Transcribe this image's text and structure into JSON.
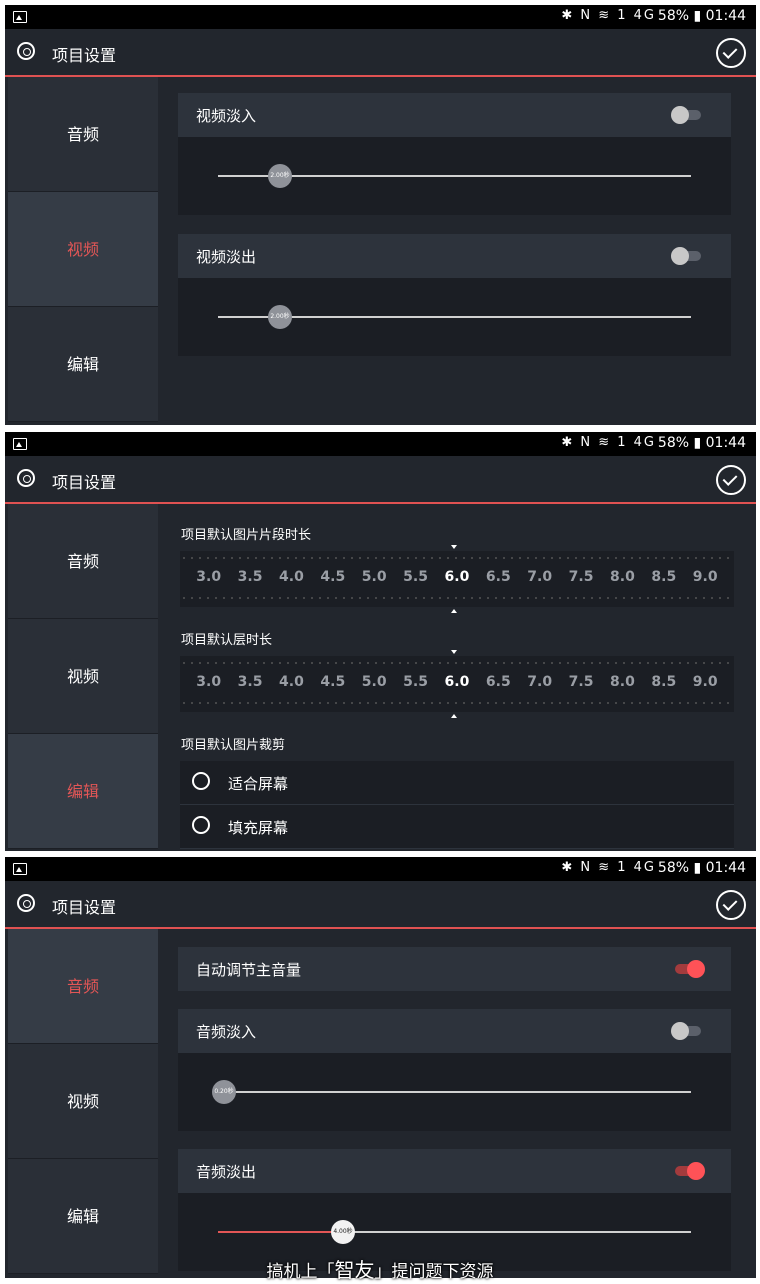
{
  "status_bar": {
    "icons": "✱ N ≋ 1 4G",
    "battery": "58%",
    "time": "01:44"
  },
  "app_bar": {
    "title": "项目设置"
  },
  "sidebar": {
    "audio": "音频",
    "video": "视频",
    "edit": "编辑"
  },
  "video_panel": {
    "fade_in": {
      "label": "视频淡入",
      "value_label": "2.00秒",
      "enabled": false,
      "position": 0.14
    },
    "fade_out": {
      "label": "视频淡出",
      "value_label": "2.00秒",
      "enabled": false,
      "position": 0.14
    }
  },
  "edit_panel": {
    "image_clip_duration": {
      "label": "项目默认图片片段时长",
      "values": [
        "3.0",
        "3.5",
        "4.0",
        "4.5",
        "5.0",
        "5.5",
        "6.0",
        "6.5",
        "7.0",
        "7.5",
        "8.0",
        "8.5",
        "9.0"
      ],
      "selected": "6.0"
    },
    "layer_duration": {
      "label": "项目默认层时长",
      "values": [
        "3.0",
        "3.5",
        "4.0",
        "4.5",
        "5.0",
        "5.5",
        "6.0",
        "6.5",
        "7.0",
        "7.5",
        "8.0",
        "8.5",
        "9.0"
      ],
      "selected": "6.0"
    },
    "image_crop": {
      "label": "项目默认图片裁剪",
      "options": [
        "适合屏幕",
        "填充屏幕"
      ]
    }
  },
  "audio_panel": {
    "auto_volume": {
      "label": "自动调节主音量",
      "enabled": true
    },
    "fade_in": {
      "label": "音频淡入",
      "value_label": "0.20秒",
      "enabled": false,
      "position": 0.0
    },
    "fade_out": {
      "label": "音频淡出",
      "value_label": "4.00秒",
      "enabled": true,
      "position": 0.27
    }
  },
  "watermark": {
    "pre": "搞机上「",
    "brand": "智友",
    "post": "」提问题下资源"
  },
  "colors": {
    "accent": "#e35656",
    "background": "#22262d",
    "card": "#2d333c"
  }
}
